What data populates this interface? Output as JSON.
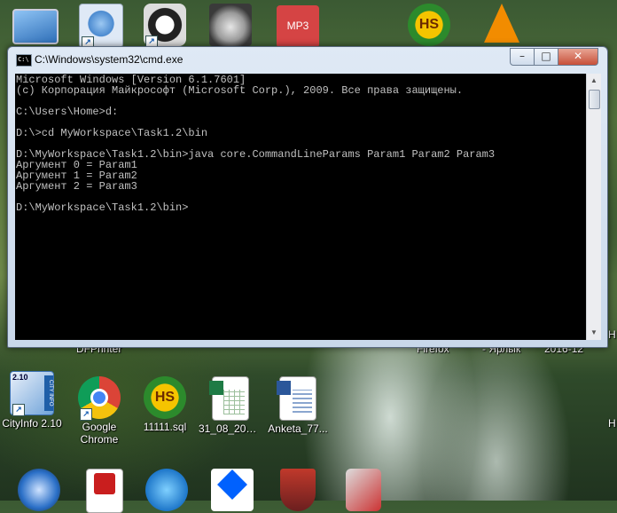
{
  "top_icons": [
    {
      "name": "computer-icon",
      "color": "#3b7fd4"
    },
    {
      "name": "network-icon",
      "color": "#6aa0e0"
    },
    {
      "name": "clock-shield-icon",
      "color": "#333"
    },
    {
      "name": "face-icon",
      "color": "#888"
    },
    {
      "name": "mp3-icon",
      "label": "MP3",
      "color": "#d93a3a"
    },
    {
      "name": "hs-icon",
      "label": "HS",
      "color": "#e4a700"
    },
    {
      "name": "vlc-icon",
      "color": "#f28c00"
    }
  ],
  "partial_labels": {
    "dfprinter": "DFPrinter",
    "firefox": "Firefox",
    "yarlyk": "- Ярлык",
    "date": "2016-12",
    "n1": "H",
    "n2": "H"
  },
  "window": {
    "title": "C:\\Windows\\system32\\cmd.exe",
    "icon_text": "C:\\",
    "min": "–",
    "max": "□",
    "close": "✕"
  },
  "console_lines": [
    "Microsoft Windows [Version 6.1.7601]",
    "(c) Корпорация Майкрософт (Microsoft Corp.), 2009. Все права защищены.",
    "",
    "C:\\Users\\Home>d:",
    "",
    "D:\\>cd MyWorkspace\\Task1.2\\bin",
    "",
    "D:\\MyWorkspace\\Task1.2\\bin>java core.CommandLineParams Param1 Param2 Param3",
    "Аргумент 0 = Param1",
    "Аргумент 1 = Param2",
    "Аргумент 2 = Param3",
    "",
    "D:\\MyWorkspace\\Task1.2\\bin>"
  ],
  "bottom_icons": [
    {
      "label": "CityInfo 2.10",
      "badge": "2.10",
      "side": "CITY INFO"
    },
    {
      "label": "Google Chrome"
    },
    {
      "label": "11111.sql",
      "text": "HS"
    },
    {
      "label": "31_08_2017..."
    },
    {
      "label": "Anketa_77..."
    }
  ]
}
